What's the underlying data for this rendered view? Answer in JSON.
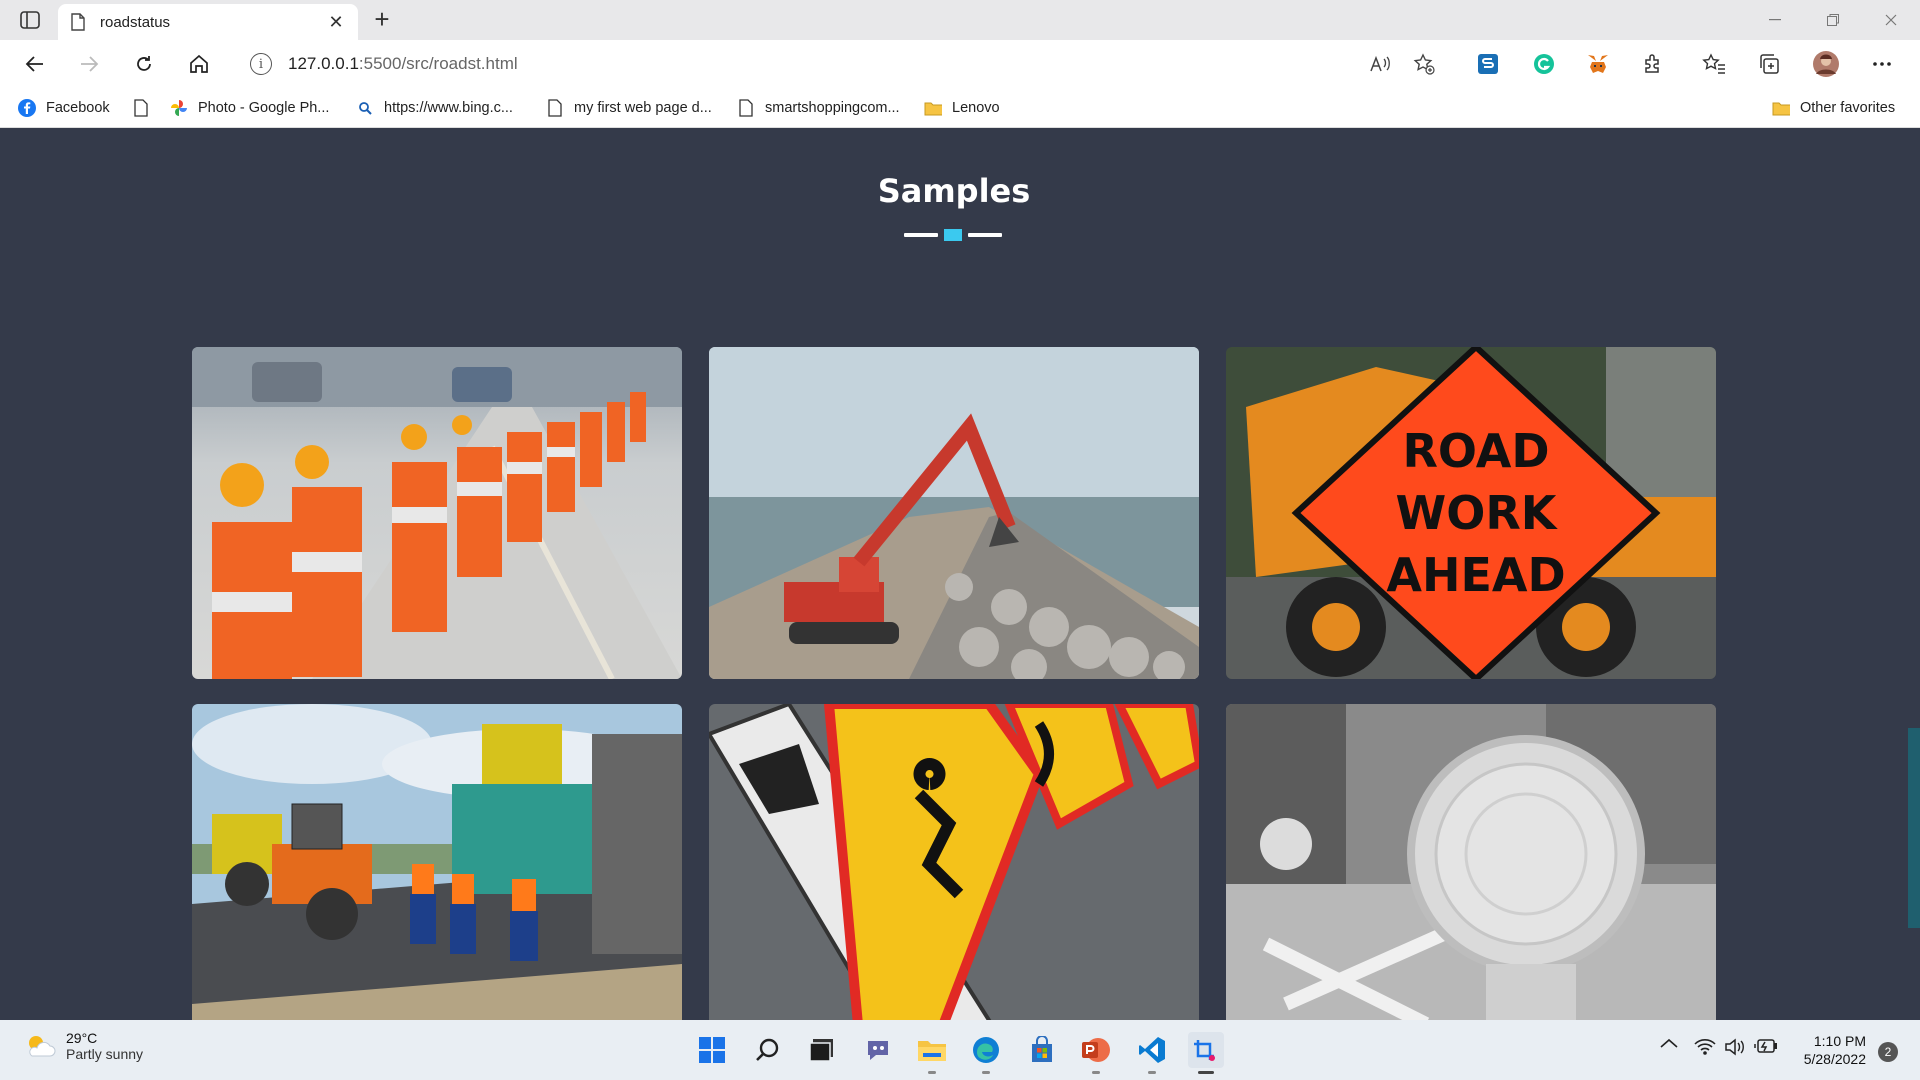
{
  "browser": {
    "tab_title": "roadstatus",
    "url_host": "127.0.0.1",
    "url_rest": ":5500/src/roadst.html",
    "new_tab_symbol": "+",
    "tab_close_symbol": "✕"
  },
  "favorites": [
    {
      "label": "Facebook",
      "icon": "facebook-icon"
    },
    {
      "label": "",
      "icon": "page-icon"
    },
    {
      "label": "Photo - Google Ph...",
      "icon": "google-photos-icon"
    },
    {
      "label": "https://www.bing.c...",
      "icon": "search-icon"
    },
    {
      "label": "my first web page d...",
      "icon": "page-icon"
    },
    {
      "label": "smartshoppingcom...",
      "icon": "page-icon"
    },
    {
      "label": "Lenovo",
      "icon": "folder-icon"
    },
    {
      "label": "Other favorites",
      "icon": "folder-icon"
    }
  ],
  "page": {
    "section_title": "Samples",
    "accent_color": "#3bc9ef",
    "background_color": "#343a4a",
    "gallery": [
      {
        "subject": "traffic-barrels"
      },
      {
        "subject": "excavator-on-rocks"
      },
      {
        "subject": "road-work-ahead-sign",
        "sign_lines": [
          "ROAD",
          "WORK",
          "AHEAD"
        ]
      },
      {
        "subject": "paving-crew"
      },
      {
        "subject": "warning-signs"
      },
      {
        "subject": "barricade-light"
      }
    ]
  },
  "taskbar": {
    "temperature": "29°C",
    "condition": "Partly sunny",
    "time": "1:10 PM",
    "date": "5/28/2022",
    "notifications": "2"
  }
}
